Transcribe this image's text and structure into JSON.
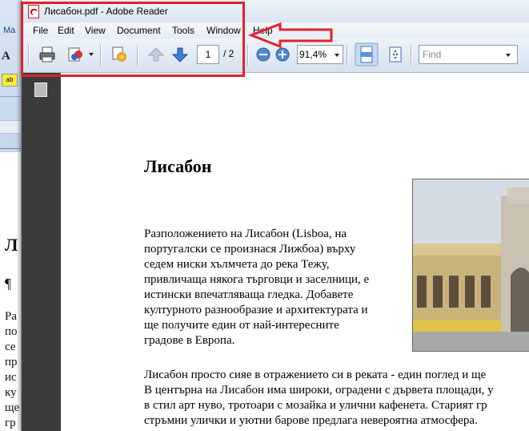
{
  "window": {
    "title": "Лисабон.pdf - Adobe Reader"
  },
  "background_app": {
    "menu_fragment": "Ma",
    "font_glyph": "A",
    "highlight_glyph": "ab",
    "heading_fragment": "Л",
    "pilcrow": "¶",
    "text_fragments": [
      "Ра",
      "по",
      "се",
      "пр",
      "ис",
      "ку",
      "ще",
      "гр"
    ]
  },
  "menu": [
    "File",
    "Edit",
    "View",
    "Document",
    "Tools",
    "Window",
    "Help"
  ],
  "toolbar": {
    "page_current": "1",
    "page_total": "/ 2",
    "zoom": "91,4%",
    "find_placeholder": "Find"
  },
  "document": {
    "title": "Лисабон",
    "paragraph1": [
      "Разположението на Лисабон (Lisboa, на",
      "португалски се произнася Лижбоа) върху",
      "седем ниски хълмчета до река Тежу,",
      "привличаща някога търговци и заселници, е",
      "истински впечатляваща гледка. Добавете",
      "културното разнообразие и архитектурата и",
      "ще получите един от най-интересните",
      "градове в Европа."
    ],
    "paragraph2": [
      "Лисабон просто сияе в отражението си в реката - един поглед и ще",
      " В центърна на Лисабон има широки, оградени с дърветa площади, у",
      "в стил арт нуво, тротоари с мозайка и улични кафенета. Старият гр",
      "стръмни улички и уютни барове предлага невероятна атмосфера."
    ]
  },
  "colors": {
    "annotation": "#e3212b",
    "nav_pane": "#3b3b3b"
  }
}
